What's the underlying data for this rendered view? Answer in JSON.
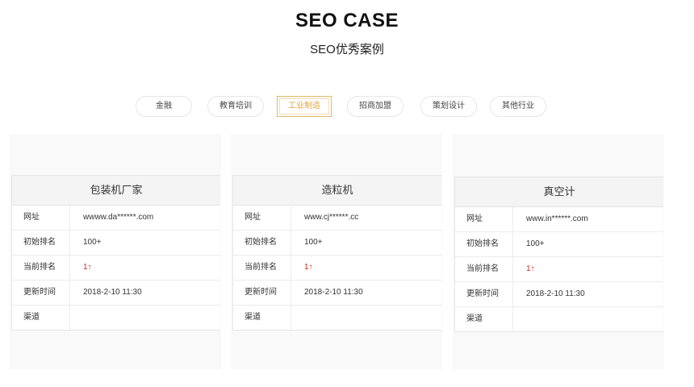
{
  "header": {
    "title": "SEO CASE",
    "subtitle": "SEO优秀案例"
  },
  "tabs": [
    {
      "label": "金融",
      "active": false
    },
    {
      "label": "教育培训",
      "active": false
    },
    {
      "label": "工业制造",
      "active": true
    },
    {
      "label": "招商加盟",
      "active": false
    },
    {
      "label": "策划设计",
      "active": false
    },
    {
      "label": "其他行业",
      "active": false
    }
  ],
  "field_labels": {
    "url": "网址",
    "initial_rank": "初始排名",
    "current_rank": "当前排名",
    "update_time": "更新时间",
    "channel": "渠道"
  },
  "cases": [
    {
      "title": "包装机厂家",
      "url": "wwww.da******.com",
      "initial_rank": "100+",
      "current_rank": "1↑",
      "update_time": "2018-2-10 11:30",
      "channel": ""
    },
    {
      "title": "造粒机",
      "url": "www.cj******.cc",
      "initial_rank": "100+",
      "current_rank": "1↑",
      "update_time": "2018-2-10 11:30",
      "channel": ""
    },
    {
      "title": "真空计",
      "url": "www.in******.com",
      "initial_rank": "100+",
      "current_rank": "1↑",
      "update_time": "2018-2-10 11:30",
      "channel": ""
    }
  ],
  "colors": {
    "active_tab": "#e3a43c",
    "rank_up": "#cc2a1f"
  }
}
